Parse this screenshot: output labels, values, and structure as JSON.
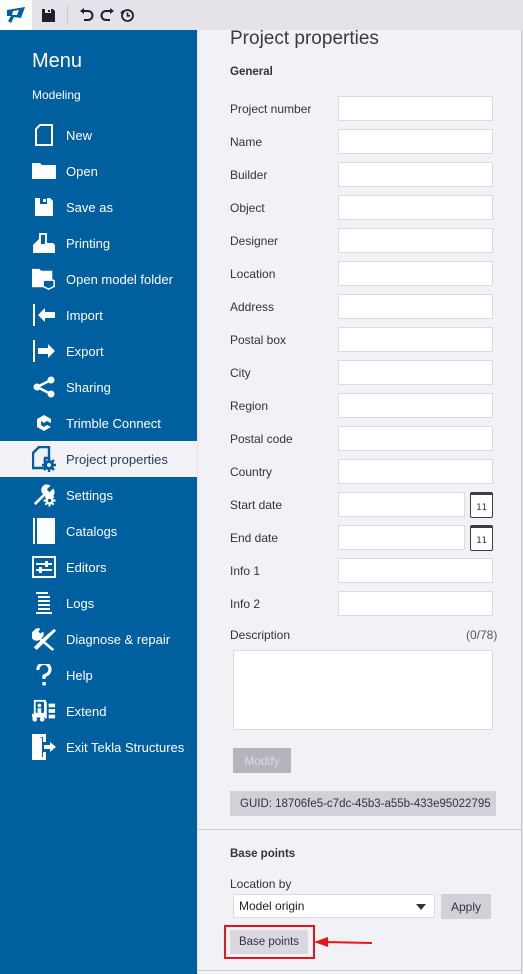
{
  "toolbar": {
    "logo": "tekla-logo-icon",
    "buttons": [
      {
        "name": "save",
        "icon": "floppy-disk-icon"
      },
      {
        "name": "undo",
        "icon": "undo-icon"
      },
      {
        "name": "redo",
        "icon": "redo-icon"
      },
      {
        "name": "history",
        "icon": "history-icon"
      }
    ]
  },
  "sidebar": {
    "title": "Menu",
    "subtitle": "Modeling",
    "items": [
      {
        "label": "New",
        "icon": "new-document-icon"
      },
      {
        "label": "Open",
        "icon": "folder-icon"
      },
      {
        "label": "Save as",
        "icon": "save-icon"
      },
      {
        "label": "Printing",
        "icon": "printer-icon"
      },
      {
        "label": "Open model folder",
        "icon": "model-folder-icon"
      },
      {
        "label": "Import",
        "icon": "import-icon"
      },
      {
        "label": "Export",
        "icon": "export-icon"
      },
      {
        "label": "Sharing",
        "icon": "share-icon"
      },
      {
        "label": "Trimble Connect",
        "icon": "trimble-connect-icon"
      },
      {
        "label": "Project properties",
        "icon": "project-properties-icon",
        "active": true
      },
      {
        "label": "Settings",
        "icon": "settings-wrench-gear-icon"
      },
      {
        "label": "Catalogs",
        "icon": "catalog-book-icon"
      },
      {
        "label": "Editors",
        "icon": "editors-sliders-icon"
      },
      {
        "label": "Logs",
        "icon": "logs-lines-icon"
      },
      {
        "label": "Diagnose & repair",
        "icon": "tools-icon"
      },
      {
        "label": "Help",
        "icon": "question-mark-icon"
      },
      {
        "label": "Extend",
        "icon": "forklift-icon"
      },
      {
        "label": "Exit Tekla Structures",
        "icon": "exit-door-icon"
      }
    ]
  },
  "panel": {
    "title": "Project properties",
    "general_title": "General",
    "fields": [
      {
        "label": "Project number",
        "value": ""
      },
      {
        "label": "Name",
        "value": ""
      },
      {
        "label": "Builder",
        "value": ""
      },
      {
        "label": "Object",
        "value": ""
      },
      {
        "label": "Designer",
        "value": ""
      },
      {
        "label": "Location",
        "value": ""
      },
      {
        "label": "Address",
        "value": ""
      },
      {
        "label": "Postal box",
        "value": ""
      },
      {
        "label": "City",
        "value": ""
      },
      {
        "label": "Region",
        "value": ""
      },
      {
        "label": "Postal code",
        "value": ""
      },
      {
        "label": "Country",
        "value": ""
      },
      {
        "label": "Start date",
        "value": "",
        "date": true
      },
      {
        "label": "End date",
        "value": "",
        "date": true
      },
      {
        "label": "Info 1",
        "value": ""
      },
      {
        "label": "Info 2",
        "value": ""
      }
    ],
    "calendar_glyph": "11",
    "description_label": "Description",
    "description_count": "(0/78)",
    "description_value": "",
    "modify_label": "Modify",
    "guid": "GUID: 18706fe5-c7dc-45b3-a55b-433e95022795",
    "base_points": {
      "title": "Base points",
      "location_label": "Location by",
      "location_selected": "Model origin",
      "apply_label": "Apply",
      "base_points_button": "Base points"
    }
  },
  "annotation": {
    "highlight_color": "#e8141c",
    "target": "Base points button"
  },
  "colors": {
    "sidebar_bg": "#005f9e",
    "panel_bg": "#f2f1f6",
    "active_item_bg": "#f2f1f6"
  }
}
